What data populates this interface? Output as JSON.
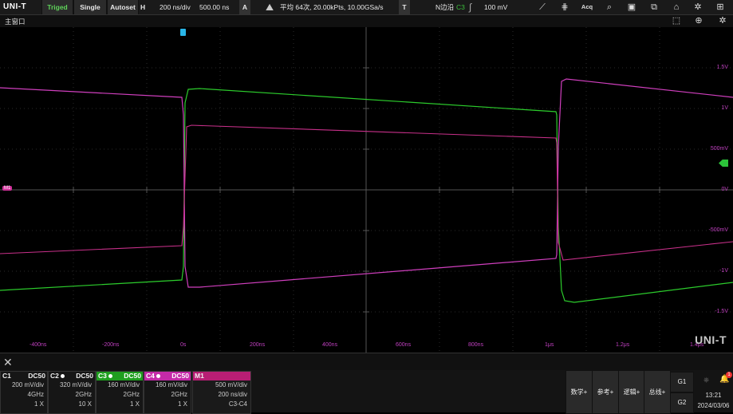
{
  "topbar": {
    "logo": "UNI-T",
    "trig_status": "Triged",
    "single": "Single",
    "autoset": "Autoset",
    "h_label": "H",
    "timebase": "200 ns/div",
    "h_position": "500.00 ns",
    "acq_label": "A",
    "acq_mode": "平均 64次, 20.00kPts, 10.00GSa/s",
    "trig_label": "T",
    "trig_type": "N边沿",
    "trig_source": "C3",
    "trig_level": "100 mV",
    "icons": [
      "cursor-icon",
      "measure-grid-icon",
      "acq-icon",
      "search-icon",
      "save-icon",
      "screenshot-icon",
      "clear-icon",
      "settings-icon",
      "layout-icon"
    ],
    "acq_icon_label": "Acq"
  },
  "subbar": {
    "title": "主窗口",
    "icons": [
      "zoom-window-icon",
      "zoom-icon",
      "settings-icon"
    ]
  },
  "plot": {
    "y_labels": [
      "1.5V",
      "1V",
      "500mV",
      "0V",
      "-500mV",
      "-1V",
      "-1.5V"
    ],
    "x_labels": [
      "-400ns",
      "-200ns",
      "0s",
      "200ns",
      "400ns",
      "600ns",
      "800ns",
      "1μs",
      "1.2μs",
      "1.4μs"
    ],
    "math_marker": "M1",
    "watermark": "UNI-T",
    "trace_colors": {
      "c3": "#2ccc2c",
      "c4": "#d03fbe"
    }
  },
  "channels": [
    {
      "name": "C1",
      "coupling": "DC50",
      "scale": "200 mV/div",
      "bw": "4GHz",
      "probe": "1 X",
      "dot": false
    },
    {
      "name": "C2",
      "coupling": "DC50",
      "scale": "320 mV/div",
      "bw": "2GHz",
      "probe": "10 X",
      "dot": true
    },
    {
      "name": "C3",
      "coupling": "DC50",
      "scale": "160 mV/div",
      "bw": "2GHz",
      "probe": "1 X",
      "dot": true
    },
    {
      "name": "C4",
      "coupling": "DC50",
      "scale": "160 mV/div",
      "bw": "2GHz",
      "probe": "1 X",
      "dot": true
    }
  ],
  "math": {
    "name": "M1",
    "scale": "500 mV/div",
    "timebase": "200 ns/div",
    "expr": "C3-C4"
  },
  "right_buttons": [
    "数学+",
    "参考+",
    "逻辑+",
    "总线+"
  ],
  "groups": [
    "G1",
    "G2"
  ],
  "status": {
    "time": "13:21",
    "date": "2024/03/06",
    "notifications": "1"
  }
}
